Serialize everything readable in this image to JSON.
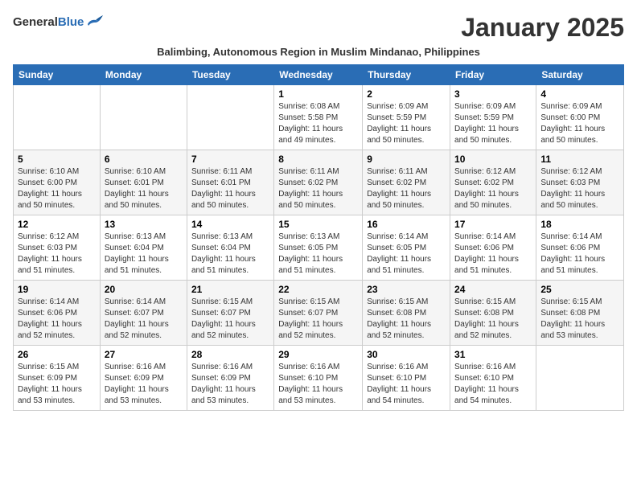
{
  "header": {
    "logo_general": "General",
    "logo_blue": "Blue",
    "month_title": "January 2025",
    "subtitle": "Balimbing, Autonomous Region in Muslim Mindanao, Philippines"
  },
  "days_of_week": [
    "Sunday",
    "Monday",
    "Tuesday",
    "Wednesday",
    "Thursday",
    "Friday",
    "Saturday"
  ],
  "weeks": [
    [
      {
        "day": "",
        "info": ""
      },
      {
        "day": "",
        "info": ""
      },
      {
        "day": "",
        "info": ""
      },
      {
        "day": "1",
        "info": "Sunrise: 6:08 AM\nSunset: 5:58 PM\nDaylight: 11 hours and 49 minutes."
      },
      {
        "day": "2",
        "info": "Sunrise: 6:09 AM\nSunset: 5:59 PM\nDaylight: 11 hours and 50 minutes."
      },
      {
        "day": "3",
        "info": "Sunrise: 6:09 AM\nSunset: 5:59 PM\nDaylight: 11 hours and 50 minutes."
      },
      {
        "day": "4",
        "info": "Sunrise: 6:09 AM\nSunset: 6:00 PM\nDaylight: 11 hours and 50 minutes."
      }
    ],
    [
      {
        "day": "5",
        "info": "Sunrise: 6:10 AM\nSunset: 6:00 PM\nDaylight: 11 hours and 50 minutes."
      },
      {
        "day": "6",
        "info": "Sunrise: 6:10 AM\nSunset: 6:01 PM\nDaylight: 11 hours and 50 minutes."
      },
      {
        "day": "7",
        "info": "Sunrise: 6:11 AM\nSunset: 6:01 PM\nDaylight: 11 hours and 50 minutes."
      },
      {
        "day": "8",
        "info": "Sunrise: 6:11 AM\nSunset: 6:02 PM\nDaylight: 11 hours and 50 minutes."
      },
      {
        "day": "9",
        "info": "Sunrise: 6:11 AM\nSunset: 6:02 PM\nDaylight: 11 hours and 50 minutes."
      },
      {
        "day": "10",
        "info": "Sunrise: 6:12 AM\nSunset: 6:02 PM\nDaylight: 11 hours and 50 minutes."
      },
      {
        "day": "11",
        "info": "Sunrise: 6:12 AM\nSunset: 6:03 PM\nDaylight: 11 hours and 50 minutes."
      }
    ],
    [
      {
        "day": "12",
        "info": "Sunrise: 6:12 AM\nSunset: 6:03 PM\nDaylight: 11 hours and 51 minutes."
      },
      {
        "day": "13",
        "info": "Sunrise: 6:13 AM\nSunset: 6:04 PM\nDaylight: 11 hours and 51 minutes."
      },
      {
        "day": "14",
        "info": "Sunrise: 6:13 AM\nSunset: 6:04 PM\nDaylight: 11 hours and 51 minutes."
      },
      {
        "day": "15",
        "info": "Sunrise: 6:13 AM\nSunset: 6:05 PM\nDaylight: 11 hours and 51 minutes."
      },
      {
        "day": "16",
        "info": "Sunrise: 6:14 AM\nSunset: 6:05 PM\nDaylight: 11 hours and 51 minutes."
      },
      {
        "day": "17",
        "info": "Sunrise: 6:14 AM\nSunset: 6:06 PM\nDaylight: 11 hours and 51 minutes."
      },
      {
        "day": "18",
        "info": "Sunrise: 6:14 AM\nSunset: 6:06 PM\nDaylight: 11 hours and 51 minutes."
      }
    ],
    [
      {
        "day": "19",
        "info": "Sunrise: 6:14 AM\nSunset: 6:06 PM\nDaylight: 11 hours and 52 minutes."
      },
      {
        "day": "20",
        "info": "Sunrise: 6:14 AM\nSunset: 6:07 PM\nDaylight: 11 hours and 52 minutes."
      },
      {
        "day": "21",
        "info": "Sunrise: 6:15 AM\nSunset: 6:07 PM\nDaylight: 11 hours and 52 minutes."
      },
      {
        "day": "22",
        "info": "Sunrise: 6:15 AM\nSunset: 6:07 PM\nDaylight: 11 hours and 52 minutes."
      },
      {
        "day": "23",
        "info": "Sunrise: 6:15 AM\nSunset: 6:08 PM\nDaylight: 11 hours and 52 minutes."
      },
      {
        "day": "24",
        "info": "Sunrise: 6:15 AM\nSunset: 6:08 PM\nDaylight: 11 hours and 52 minutes."
      },
      {
        "day": "25",
        "info": "Sunrise: 6:15 AM\nSunset: 6:08 PM\nDaylight: 11 hours and 53 minutes."
      }
    ],
    [
      {
        "day": "26",
        "info": "Sunrise: 6:15 AM\nSunset: 6:09 PM\nDaylight: 11 hours and 53 minutes."
      },
      {
        "day": "27",
        "info": "Sunrise: 6:16 AM\nSunset: 6:09 PM\nDaylight: 11 hours and 53 minutes."
      },
      {
        "day": "28",
        "info": "Sunrise: 6:16 AM\nSunset: 6:09 PM\nDaylight: 11 hours and 53 minutes."
      },
      {
        "day": "29",
        "info": "Sunrise: 6:16 AM\nSunset: 6:10 PM\nDaylight: 11 hours and 53 minutes."
      },
      {
        "day": "30",
        "info": "Sunrise: 6:16 AM\nSunset: 6:10 PM\nDaylight: 11 hours and 54 minutes."
      },
      {
        "day": "31",
        "info": "Sunrise: 6:16 AM\nSunset: 6:10 PM\nDaylight: 11 hours and 54 minutes."
      },
      {
        "day": "",
        "info": ""
      }
    ]
  ]
}
